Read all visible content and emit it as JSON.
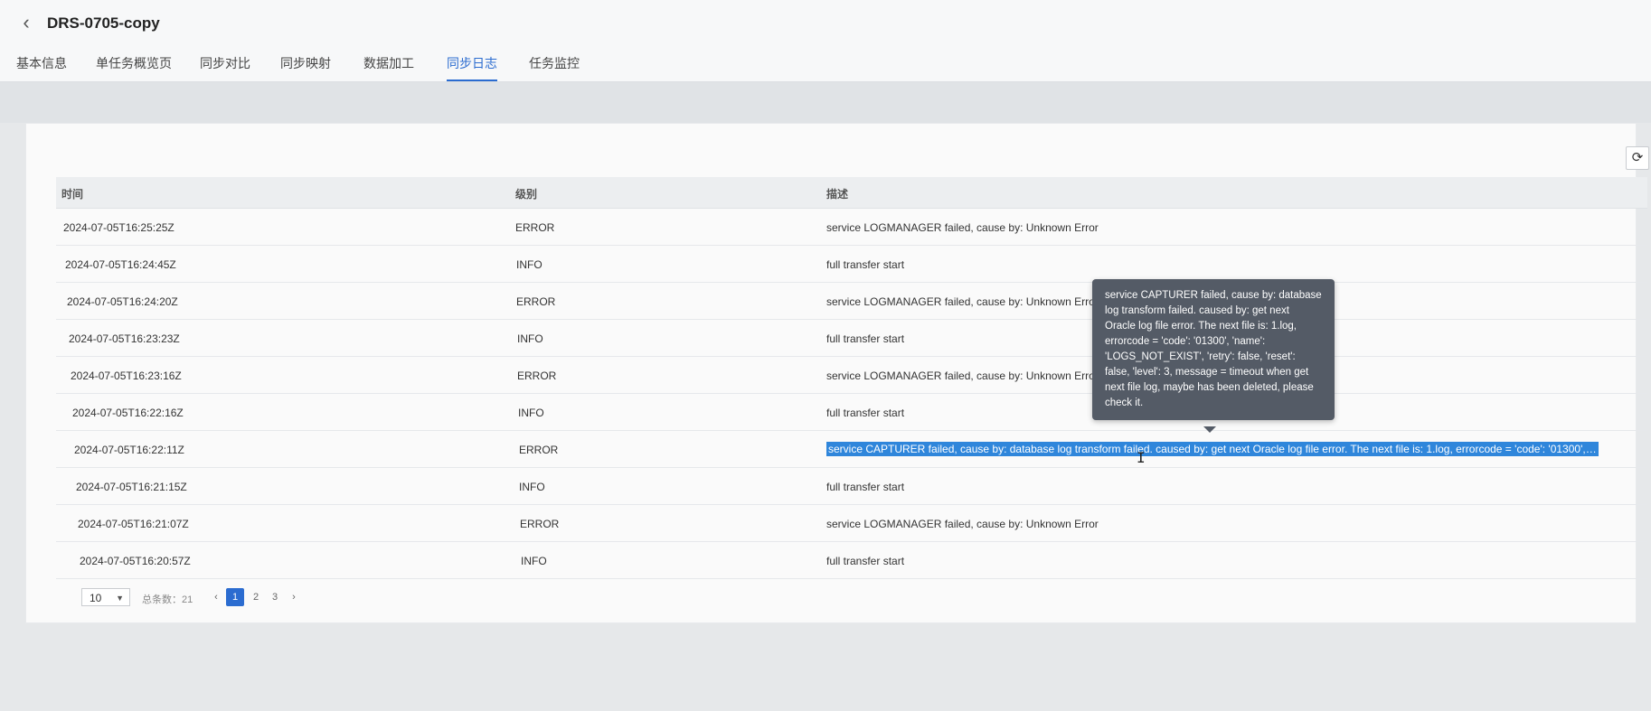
{
  "header": {
    "title": "DRS-0705-copy",
    "back_icon": "chevron-left-icon"
  },
  "tabs": [
    {
      "label": "基本信息"
    },
    {
      "label": "单任务概览页"
    },
    {
      "label": "同步对比"
    },
    {
      "label": "同步映射"
    },
    {
      "label": "数据加工"
    },
    {
      "label": "同步日志",
      "active": true
    },
    {
      "label": "任务监控"
    }
  ],
  "toolbar": {
    "refresh_icon": "refresh-icon"
  },
  "table": {
    "columns": {
      "time": "时间",
      "level": "级别",
      "description": "描述"
    },
    "rows": [
      {
        "time": "2024-07-05T16:25:25Z",
        "level": "ERROR",
        "description": "service LOGMANAGER failed, cause by: Unknown Error"
      },
      {
        "time": "2024-07-05T16:24:45Z",
        "level": "INFO",
        "description": "full transfer start"
      },
      {
        "time": "2024-07-05T16:24:20Z",
        "level": "ERROR",
        "description": "service LOGMANAGER failed, cause by: Unknown Error"
      },
      {
        "time": "2024-07-05T16:23:23Z",
        "level": "INFO",
        "description": "full transfer start"
      },
      {
        "time": "2024-07-05T16:23:16Z",
        "level": "ERROR",
        "description": "service LOGMANAGER failed, cause by: Unknown Error"
      },
      {
        "time": "2024-07-05T16:22:16Z",
        "level": "INFO",
        "description": "full transfer start"
      },
      {
        "time": "2024-07-05T16:22:11Z",
        "level": "ERROR",
        "description": "service CAPTURER failed, cause by: database log transform failed. caused by: get next Oracle log file error. The next file is: 1.log, errorcode = 'code': '01300', 'nam...",
        "selected": true
      },
      {
        "time": "2024-07-05T16:21:15Z",
        "level": "INFO",
        "description": "full transfer start"
      },
      {
        "time": "2024-07-05T16:21:07Z",
        "level": "ERROR",
        "description": "service LOGMANAGER failed, cause by: Unknown Error"
      },
      {
        "time": "2024-07-05T16:20:57Z",
        "level": "INFO",
        "description": "full transfer start"
      }
    ]
  },
  "pagination": {
    "page_size": "10",
    "total_label": "总条数：21",
    "pages": [
      "1",
      "2",
      "3"
    ],
    "current_page": "1",
    "prev_icon": "chevron-left-icon",
    "next_icon": "chevron-right-icon",
    "prev_label": "‹",
    "next_label": "›"
  },
  "tooltip": {
    "text": "service CAPTURER failed, cause by: database log transform failed. caused by: get next Oracle log file error. The next file is: 1.log, errorcode = 'code': '01300', 'name': 'LOGS_NOT_EXIST', 'retry': false, 'reset': false, 'level': 3, message = timeout when get next file log, maybe has been deleted, please check it."
  }
}
